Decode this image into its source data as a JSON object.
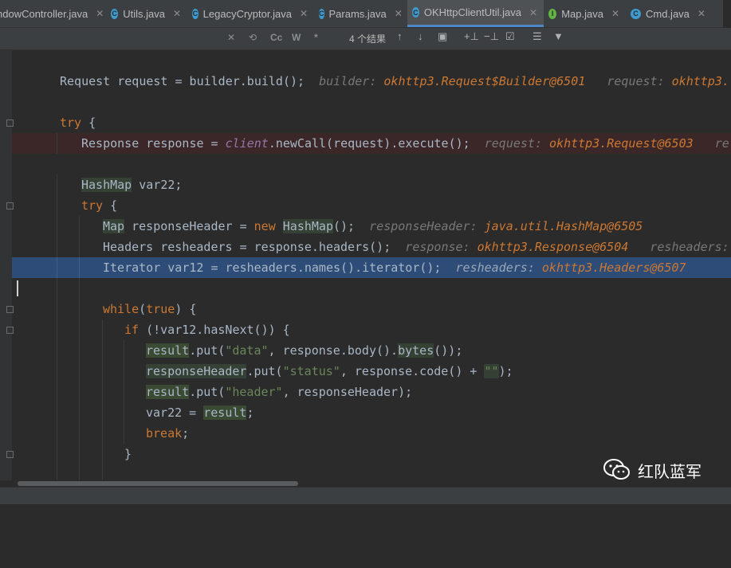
{
  "tabs": [
    {
      "label": "ndowController.java",
      "icon": "class-icon",
      "active": false
    },
    {
      "label": "Utils.java",
      "icon": "class-icon",
      "active": false
    },
    {
      "label": "LegacyCryptor.java",
      "icon": "class-icon",
      "active": false
    },
    {
      "label": "Params.java",
      "icon": "class-icon",
      "active": false
    },
    {
      "label": "OKHttpClientUtil.java",
      "icon": "class-icon",
      "active": true
    },
    {
      "label": "Map.java",
      "icon": "interface-icon",
      "active": false
    },
    {
      "label": "Cmd.java",
      "icon": "class-icon",
      "active": false
    }
  ],
  "search": {
    "results": "4 个结果",
    "match_case": "Cc",
    "words": "W",
    "regex": "*"
  },
  "code": {
    "l1": {
      "code": "Request request = builder.build();",
      "hint1_name": "builder:",
      "hint1_value": "okhttp3.Request$Builder@6501",
      "hint2_name": "request:",
      "hint2_value": "okhttp3."
    },
    "l2": {
      "kw": "try",
      "rest": " {"
    },
    "l3": {
      "p1": "Response response = ",
      "field": "client",
      "p2": ".newCall(request).execute();",
      "hint1_name": "request:",
      "hint1_value": "okhttp3.Request@6503",
      "hint2_name": "re"
    },
    "l4": {
      "type": "HashMap",
      "rest": " var22;"
    },
    "l5": {
      "kw": "try",
      "rest": " {"
    },
    "l6": {
      "type": "Map",
      "p1": " responseHeader = ",
      "kw": "new",
      "sp": " ",
      "type2": "HashMap",
      "p2": "();",
      "hint_name": "responseHeader:",
      "hint_value": "java.util.HashMap@6505"
    },
    "l7": {
      "code": "Headers resheaders = response.headers();",
      "hint1_name": "response:",
      "hint1_value": "okhttp3.Response@6504",
      "hint2_name": "resheaders:"
    },
    "l8": {
      "code": "Iterator var12 = resheaders.names().iterator();",
      "hint_name": "resheaders:",
      "hint_value": "okhttp3.Headers@6507"
    },
    "l10": {
      "kw1": "while",
      "p1": "(",
      "kw2": "true",
      "p2": ") {"
    },
    "l11": {
      "kw": "if",
      "rest": " (!var12.hasNext()) {"
    },
    "l12": {
      "v": "result",
      "p1": ".put(",
      "s1": "\"data\"",
      "p2": ", response.body().",
      "m": "bytes",
      "p3": "());"
    },
    "l13": {
      "v": "responseHeader",
      "p1": ".put(",
      "s1": "\"status\"",
      "p2": ", response.code() + ",
      "s2": "\"\"",
      "p3": ");"
    },
    "l14": {
      "v": "result",
      "p1": ".put(",
      "s1": "\"header\"",
      "p2": ", responseHeader);"
    },
    "l15": {
      "p1": "var22 = ",
      "v": "result",
      "p2": ";"
    },
    "l16": {
      "kw": "break",
      "p": ";"
    },
    "l17": {
      "code": "}"
    }
  },
  "watermark": {
    "text": "红队蓝军"
  },
  "colors": {
    "background": "#2b2b2b",
    "keyword": "#cc7832",
    "string": "#6a8759",
    "field": "#9876aa",
    "selection": "#2d4c78",
    "error_line": "#3b2727"
  }
}
